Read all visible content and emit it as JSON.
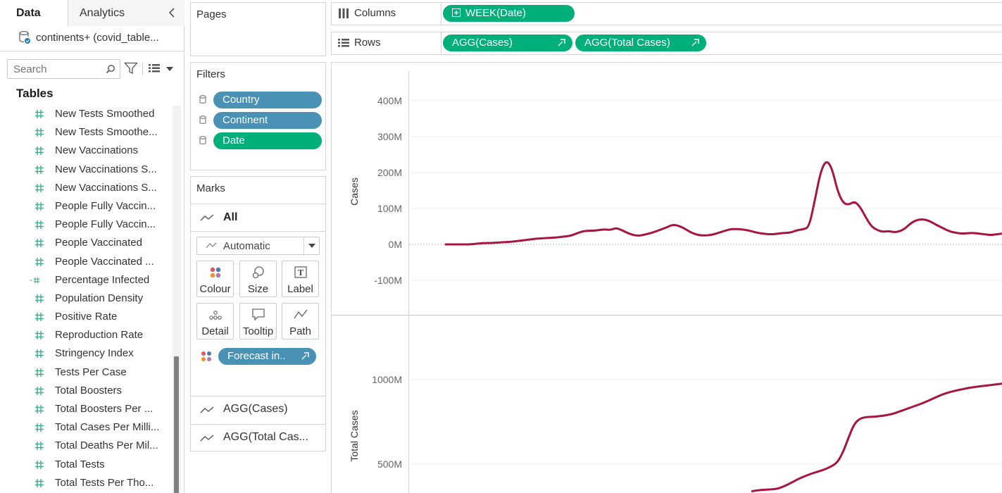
{
  "data_pane": {
    "tabs": [
      "Data",
      "Analytics"
    ],
    "datasource": "continents+ (covid_table...",
    "search_placeholder": "Search",
    "tables_heading": "Tables",
    "fields": [
      {
        "label": "New Tests Smoothed",
        "type": "measure"
      },
      {
        "label": "New Tests Smoothe...",
        "type": "measure"
      },
      {
        "label": "New Vaccinations",
        "type": "measure"
      },
      {
        "label": "New Vaccinations S...",
        "type": "measure"
      },
      {
        "label": "New Vaccinations S...",
        "type": "measure"
      },
      {
        "label": "People Fully Vaccin...",
        "type": "measure"
      },
      {
        "label": "People Fully Vaccin...",
        "type": "measure"
      },
      {
        "label": "People Vaccinated",
        "type": "measure"
      },
      {
        "label": "People Vaccinated ...",
        "type": "measure"
      },
      {
        "label": "Percentage Infected",
        "type": "calculated"
      },
      {
        "label": "Population Density",
        "type": "measure"
      },
      {
        "label": "Positive Rate",
        "type": "measure"
      },
      {
        "label": "Reproduction Rate",
        "type": "measure"
      },
      {
        "label": "Stringency Index",
        "type": "measure"
      },
      {
        "label": "Tests Per Case",
        "type": "measure"
      },
      {
        "label": "Total Boosters",
        "type": "measure"
      },
      {
        "label": "Total Boosters Per ...",
        "type": "measure"
      },
      {
        "label": "Total Cases Per Milli...",
        "type": "measure"
      },
      {
        "label": "Total Deaths Per Mil...",
        "type": "measure"
      },
      {
        "label": "Total Tests",
        "type": "measure"
      },
      {
        "label": "Total Tests Per Tho...",
        "type": "measure"
      }
    ]
  },
  "pages": {
    "title": "Pages"
  },
  "filters": {
    "title": "Filters",
    "items": [
      {
        "label": "Country",
        "color": "blue"
      },
      {
        "label": "Continent",
        "color": "blue"
      },
      {
        "label": "Date",
        "color": "green"
      }
    ]
  },
  "marks": {
    "title": "Marks",
    "all_label": "All",
    "mark_type": "Automatic",
    "buttons": [
      "Colour",
      "Size",
      "Label",
      "Detail",
      "Tooltip",
      "Path"
    ],
    "colour_pill": "Forecast in..",
    "sub_cards": [
      "AGG(Cases)",
      "AGG(Total Cas..."
    ]
  },
  "shelves": {
    "columns": {
      "label": "Columns",
      "pills": [
        "WEEK(Date)"
      ]
    },
    "rows": {
      "label": "Rows",
      "pills": [
        "AGG(Cases)",
        "AGG(Total Cases)"
      ]
    }
  },
  "colors": {
    "line": "#a8153f",
    "pill_green": "#00af7a",
    "pill_blue": "#4a92b5",
    "field_icon": "#3fae8c"
  },
  "chart_data": [
    {
      "type": "line",
      "ylabel": "Cases",
      "y_ticks": [
        "400M",
        "300M",
        "200M",
        "100M",
        "0M",
        "-100M"
      ],
      "ylim": [
        -180,
        460
      ],
      "zero_line": true,
      "series": [
        {
          "values": [
            0,
            0,
            0,
            0,
            0,
            1,
            3,
            4,
            4,
            5,
            6,
            7,
            8,
            10,
            12,
            14,
            16,
            17,
            18,
            19,
            20,
            22,
            24,
            30,
            36,
            38,
            38,
            40,
            42,
            40,
            46,
            40,
            32,
            26,
            24,
            27,
            31,
            36,
            42,
            48,
            55,
            52,
            45,
            35,
            28,
            25,
            25,
            27,
            32,
            37,
            42,
            43,
            42,
            40,
            36,
            32,
            30,
            28,
            29,
            31,
            32,
            34,
            40,
            42,
            48,
            120,
            200,
            235,
            215,
            150,
            115,
            110,
            120,
            105,
            75,
            50,
            40,
            35,
            37,
            34,
            36,
            45,
            60,
            68,
            70,
            67,
            58,
            50,
            42,
            35,
            32,
            30,
            31,
            32,
            30,
            28,
            26,
            28,
            30,
            33
          ]
        }
      ]
    },
    {
      "type": "line",
      "ylabel": "Total Cases",
      "y_ticks": [
        "1000M",
        "500M"
      ],
      "ylim": [
        300,
        1240
      ],
      "series": [
        {
          "values": [
            0,
            0,
            0,
            0,
            0,
            0,
            0,
            0,
            0,
            0,
            0,
            0,
            0,
            0,
            0,
            0,
            0,
            0,
            0,
            0,
            0,
            0,
            0,
            0,
            0,
            0,
            0,
            0,
            0,
            0,
            0,
            0,
            0,
            0,
            0,
            0,
            0,
            0,
            0,
            0,
            0,
            0,
            0,
            0,
            0,
            0,
            0,
            0,
            0,
            0,
            0,
            0,
            0,
            0,
            340,
            345,
            348,
            350,
            352,
            360,
            375,
            392,
            410,
            425,
            438,
            450,
            460,
            472,
            488,
            510,
            570,
            660,
            740,
            770,
            778,
            780,
            782,
            786,
            792,
            800,
            812,
            824,
            836,
            848,
            860,
            875,
            890,
            905,
            918,
            928,
            936,
            943,
            950,
            955,
            960,
            964,
            968,
            972,
            976,
            980
          ]
        }
      ]
    }
  ]
}
